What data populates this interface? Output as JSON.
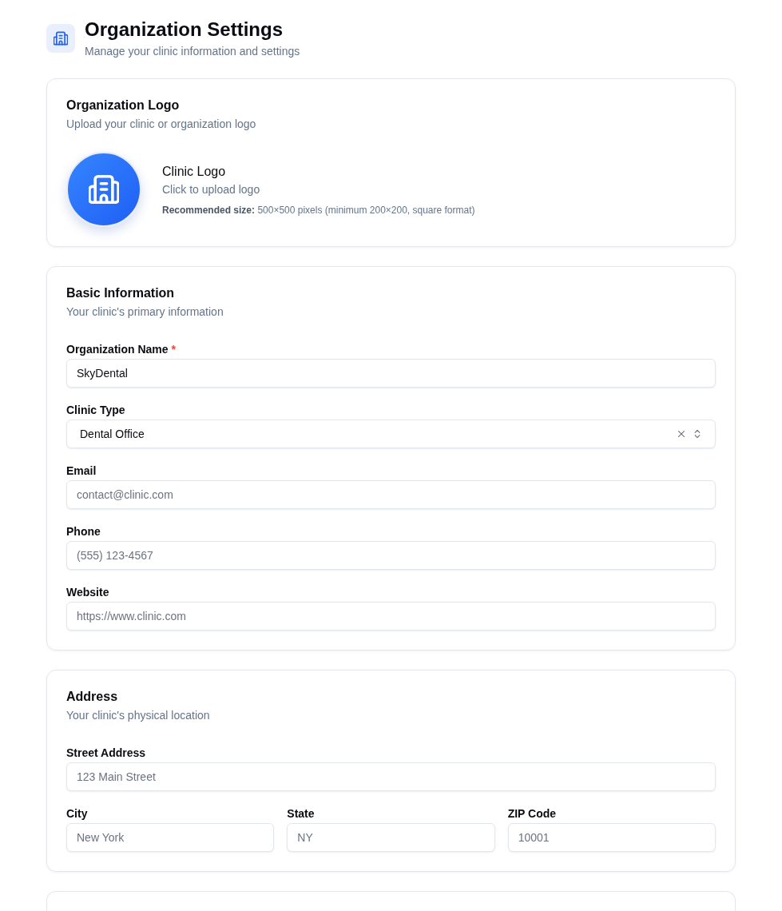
{
  "header": {
    "title": "Organization Settings",
    "subtitle": "Manage your clinic information and settings"
  },
  "logo_card": {
    "title": "Organization Logo",
    "description": "Upload your clinic or organization logo",
    "logo_label": "Clinic Logo",
    "upload_hint": "Click to upload logo",
    "size_note": "**Recommended size:** 500×500 pixels (minimum 200×200, square format)"
  },
  "sections": [
    {
      "title": "Basic Information",
      "description": "Your clinic's primary information",
      "rows": [
        [
          {
            "kind": "text",
            "label": "Organization Name",
            "required_mark": "*",
            "value": "SkyDental"
          }
        ],
        [
          {
            "kind": "select",
            "label": "Clinic Type",
            "value": "Dental Office"
          }
        ],
        [
          {
            "kind": "text",
            "label": "Email",
            "placeholder": "contact@clinic.com"
          }
        ],
        [
          {
            "kind": "text",
            "label": "Phone",
            "placeholder": "(555) 123-4567"
          }
        ],
        [
          {
            "kind": "text",
            "label": "Website",
            "placeholder": "https://www.clinic.com"
          }
        ]
      ]
    },
    {
      "title": "Address",
      "description": "Your clinic's physical location",
      "rows": [
        [
          {
            "kind": "text",
            "label": "Street Address",
            "placeholder": "123 Main Street"
          }
        ],
        [
          {
            "kind": "text",
            "label": "City",
            "placeholder": "New York"
          },
          {
            "kind": "text",
            "label": "State",
            "placeholder": "NY"
          },
          {
            "kind": "text",
            "label": "ZIP Code",
            "placeholder": "10001"
          }
        ]
      ]
    }
  ]
}
